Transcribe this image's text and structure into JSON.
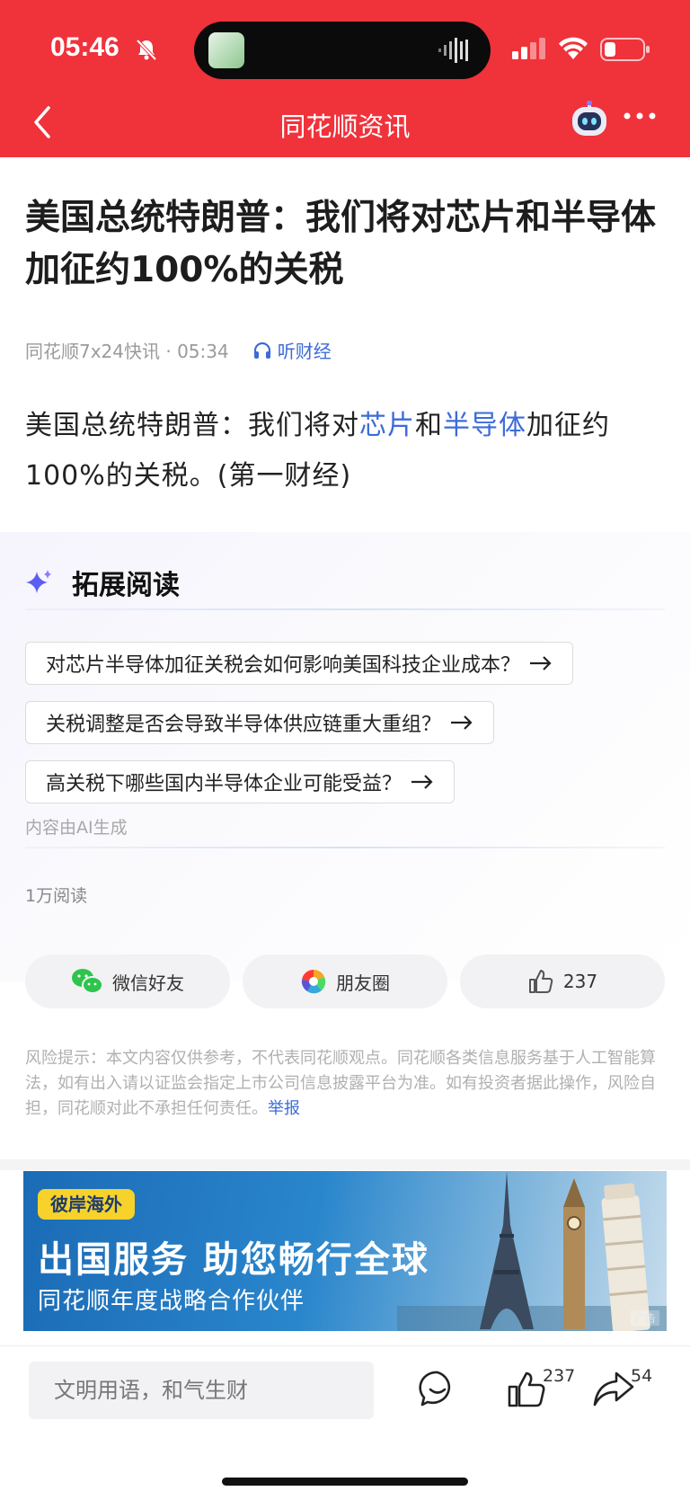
{
  "status": {
    "time": "05:46"
  },
  "nav": {
    "title": "同花顺资讯"
  },
  "article": {
    "title": "美国总统特朗普：我们将对芯片和半导体加征约100%的关税",
    "meta_source": "同花顺7x24快讯 · 05:34",
    "listen_label": "听财经",
    "body": {
      "part1": "美国总统特朗普：我们将对",
      "kw1": "芯片",
      "part2": "和",
      "kw2": "半导体",
      "part3": "加征约100%的关税。(第一财经)"
    }
  },
  "extended_reading": {
    "title": "拓展阅读",
    "questions": [
      "对芯片半导体加征关税会如何影响美国科技企业成本？",
      "关税调整是否会导致半导体供应链重大重组？",
      "高关税下哪些国内半导体企业可能受益？"
    ],
    "ai_note": "内容由AI生成"
  },
  "reads": "1万阅读",
  "share": {
    "wechat": "微信好友",
    "moments": "朋友圈",
    "likes": "237"
  },
  "risk": {
    "text": "风险提示：本文内容仅供参考，不代表同花顺观点。同花顺各类信息服务基于人工智能算法，如有出入请以证监会指定上市公司信息披露平台为准。如有投资者据此操作，风险自担，同花顺对此不承担任何责任。",
    "report": "举报"
  },
  "ad": {
    "tag": "彼岸海外",
    "headline": "出国服务 助您畅行全球",
    "sub": "同花顺年度战略合作伙伴",
    "label": "广告"
  },
  "bottom": {
    "comment_placeholder": "文明用语，和气生财",
    "like_count": "237",
    "share_count": "54"
  },
  "colors": {
    "header": "#f0323b",
    "link": "#3d6bd8"
  }
}
